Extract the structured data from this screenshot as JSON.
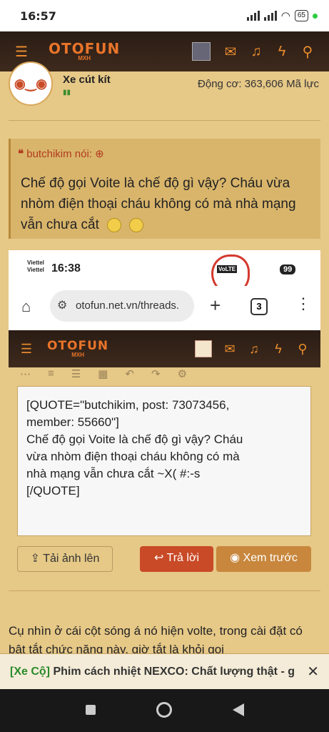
{
  "status_bar": {
    "time": "16:57",
    "battery": "65"
  },
  "app_nav": {
    "logo_text": "OTOFUN",
    "logo_sub": "MXH"
  },
  "post_header": {
    "username": "Xe cút kít",
    "badge": "▮▮",
    "engine_label": "Động cơ:",
    "engine_value": "363,606 Mã lực"
  },
  "quote": {
    "author": "butchikim nói:",
    "body": "Chế độ gọi Voite là chế độ gì vậy? Cháu vừa nhòm điện thoại cháu không có mà nhà mạng vẫn chưa cắt"
  },
  "embedded_screenshot": {
    "carrier1": "Viettel",
    "carrier2": "Viettel",
    "time": "16:38",
    "volte": "VoLTE",
    "battery": "99",
    "url": "otofun.net.vn/threads.",
    "tab_count": "3",
    "editor_text_lines": [
      "[QUOTE=\"butchikim, post: 73073456,",
      "member: 55660\"]",
      "Chế độ gọi Voite là chế độ gì vậy? Cháu",
      "vừa nhòm điện thoại cháu không có mà",
      "nhà mạng vẫn chưa cắt  ~X( #:-s",
      "[/QUOTE]"
    ],
    "upload_button": "Tải ảnh lên",
    "reply_button": "Trả lời",
    "preview_button": "Xem trước"
  },
  "post_text": "Cụ nhìn ở cái cột sóng á nó hiện volte, trong cài đặt có bật tắt chức năng này, giờ tắt là khỏi gọi",
  "ticker": {
    "tag": "[Xe Cộ]",
    "text": "Phim cách nhiệt NEXCO: Chất lượng thật - g"
  },
  "colors": {
    "accent": "#e8742a",
    "reply": "#c94a26",
    "background": "#e6c887"
  }
}
